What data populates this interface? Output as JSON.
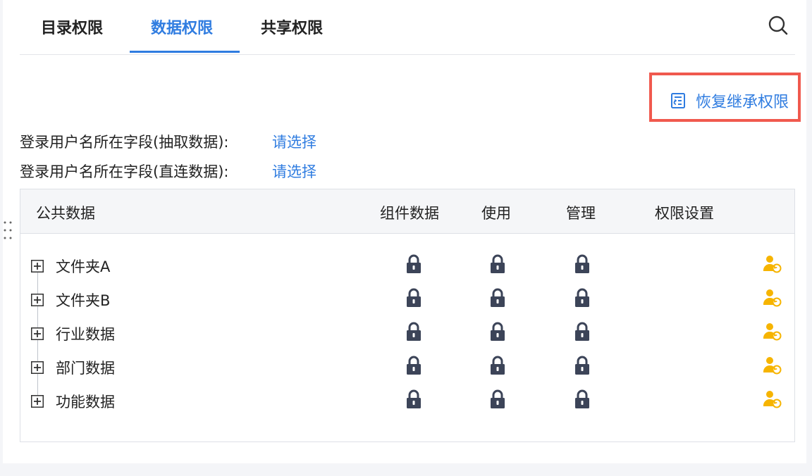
{
  "tabs": [
    {
      "label": "目录权限",
      "active": false
    },
    {
      "label": "数据权限",
      "active": true
    },
    {
      "label": "共享权限",
      "active": false
    }
  ],
  "toolbar": {
    "restore_label": "恢复继承权限",
    "search_icon": "search-icon"
  },
  "fields": [
    {
      "label": "登录用户名所在字段(抽取数据):",
      "value": "请选择"
    },
    {
      "label": "登录用户名所在字段(直连数据):",
      "value": "请选择"
    }
  ],
  "table": {
    "columns": [
      "公共数据",
      "组件数据",
      "使用",
      "管理",
      "权限设置"
    ],
    "rows": [
      {
        "label": "文件夹A",
        "component_data": "locked",
        "use": "locked",
        "manage": "locked"
      },
      {
        "label": "文件夹B",
        "component_data": "locked",
        "use": "locked",
        "manage": "locked"
      },
      {
        "label": "行业数据",
        "component_data": "locked",
        "use": "locked",
        "manage": "locked"
      },
      {
        "label": "部门数据",
        "component_data": "locked",
        "use": "locked",
        "manage": "locked"
      },
      {
        "label": "功能数据",
        "component_data": "locked",
        "use": "locked",
        "manage": "locked"
      }
    ]
  },
  "colors": {
    "accent": "#2f7ce0",
    "highlight_border": "#f0594e",
    "lock": "#3c4458",
    "permission_icon": "#f6b400"
  }
}
